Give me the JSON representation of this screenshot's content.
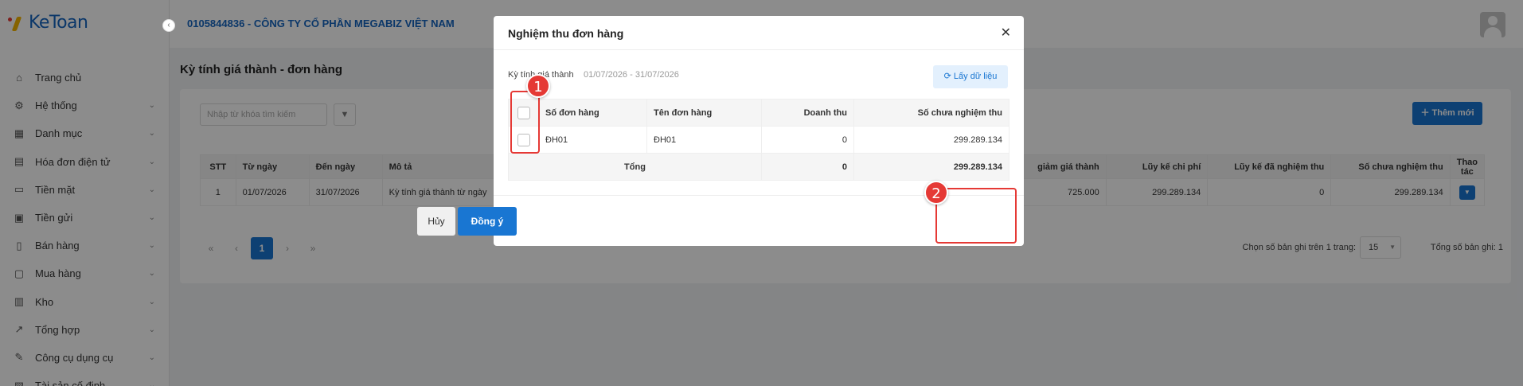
{
  "app": {
    "logo": "KeToan",
    "company": "0105844836 - CÔNG TY CỔ PHẦN MEGABIZ VIỆT NAM"
  },
  "sidebar": {
    "items": [
      {
        "label": "Trang chủ",
        "icon": "home-icon",
        "glyph": "⌂",
        "chevron": false
      },
      {
        "label": "Hệ thống",
        "icon": "gear-icon",
        "glyph": "⚙",
        "chevron": true
      },
      {
        "label": "Danh mục",
        "icon": "grid-icon",
        "glyph": "▦",
        "chevron": true
      },
      {
        "label": "Hóa đơn điện tử",
        "icon": "invoice-icon",
        "glyph": "▤",
        "chevron": true
      },
      {
        "label": "Tiền mặt",
        "icon": "cash-icon",
        "glyph": "▭",
        "chevron": true
      },
      {
        "label": "Tiền gửi",
        "icon": "bank-icon",
        "glyph": "▣",
        "chevron": true
      },
      {
        "label": "Bán hàng",
        "icon": "sales-icon",
        "glyph": "▯",
        "chevron": true
      },
      {
        "label": "Mua hàng",
        "icon": "cart-icon",
        "glyph": "▢",
        "chevron": true
      },
      {
        "label": "Kho",
        "icon": "warehouse-icon",
        "glyph": "▥",
        "chevron": true
      },
      {
        "label": "Tổng hợp",
        "icon": "chart-icon",
        "glyph": "↗",
        "chevron": true
      },
      {
        "label": "Công cụ dụng cụ",
        "icon": "tools-icon",
        "glyph": "✎",
        "chevron": true
      },
      {
        "label": "Tài sản cố định",
        "icon": "asset-icon",
        "glyph": "▧",
        "chevron": true
      }
    ]
  },
  "page": {
    "title": "Kỳ tính giá thành - đơn hàng",
    "search_placeholder": "Nhập từ khóa tìm kiếm",
    "add_button": "Thêm mới",
    "table": {
      "headers": {
        "stt": "STT",
        "from": "Từ ngày",
        "to": "Đến ngày",
        "desc": "Mô tả",
        "cost": "giảm giá thành",
        "acc_cost": "Lũy kế chi phí",
        "acc_accepted": "Lũy kế đã nghiệm thu",
        "not_accepted": "Số chưa nghiệm thu",
        "actions": "Thao tác"
      },
      "rows": [
        {
          "stt": "1",
          "from": "01/07/2026",
          "to": "31/07/2026",
          "desc": "Kỳ tính giá thành từ ngày",
          "cost": "725.000",
          "acc_cost": "299.289.134",
          "acc_accepted": "0",
          "not_accepted": "299.289.134"
        }
      ]
    },
    "pager": {
      "first": "«",
      "prev": "‹",
      "current": "1",
      "next": "›",
      "last": "»"
    },
    "rows_per_page_label": "Chọn số bản ghi trên 1 trang:",
    "rows_per_page": "15",
    "total_records": "Tổng số bản ghi: 1"
  },
  "modal": {
    "title": "Nghiệm thu đơn hàng",
    "period_label": "Kỳ tính giá thành",
    "period_value": "01/07/2026 - 31/07/2026",
    "fetch_button": "Lấy dữ liệu",
    "headers": {
      "order_no": "Số đơn hàng",
      "order_name": "Tên đơn hàng",
      "revenue": "Doanh thu",
      "not_accepted": "Số chưa nghiệm thu"
    },
    "rows": [
      {
        "order_no": "ĐH01",
        "order_name": "ĐH01",
        "revenue": "0",
        "not_accepted": "299.289.134"
      }
    ],
    "total": {
      "label": "Tổng",
      "revenue": "0",
      "not_accepted": "299.289.134"
    },
    "cancel_button": "Hủy",
    "ok_button": "Đồng ý"
  },
  "annotations": [
    {
      "number": "1"
    },
    {
      "number": "2"
    }
  ]
}
